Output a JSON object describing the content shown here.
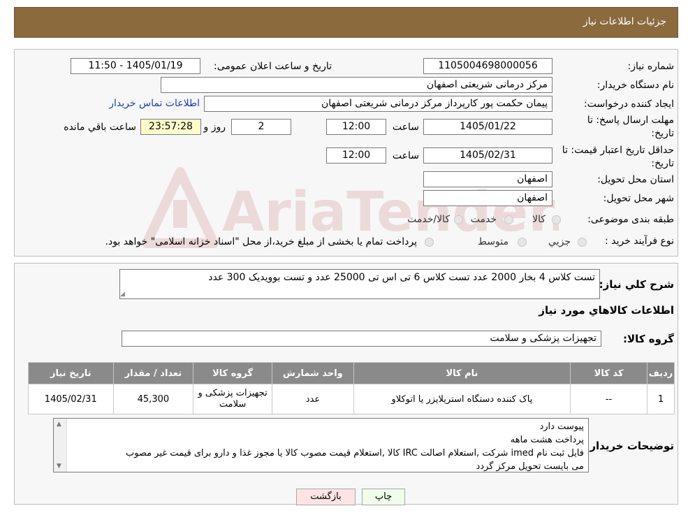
{
  "header": {
    "title": "جزئیات اطلاعات نیاز"
  },
  "fields": {
    "need_number_label": "شماره نیاز:",
    "need_number": "1105004698000056",
    "announce_label": "تاریخ و ساعت اعلان عمومی:",
    "announce_value": "1405/01/19 - 11:50",
    "buyer_org_label": "نام دستگاه خریدار:",
    "buyer_org": "مرکز درمانی شریعتی اصفهان",
    "requester_label": "ایجاد کننده درخواست:",
    "requester": "پیمان حکمت پور کارپرداز مرکز درمانی شریعتی اصفهان",
    "contact_link": "اطلاعات تماس خریدار",
    "deadline_label_1": "مهلت ارسال پاسخ: تا",
    "deadline_label_2": "تاریخ:",
    "deadline_date": "1405/01/22",
    "time_label": "ساعت",
    "deadline_time": "12:00",
    "days_value": "2",
    "days_label": "روز و",
    "remaining_time": "23:57:28",
    "remaining_label": "ساعت باقي مانده",
    "validity_label_1": "حداقل تاریخ اعتبار قیمت: تا",
    "validity_label_2": "تاریخ:",
    "validity_date": "1405/02/31",
    "validity_time": "12:00",
    "province_label": "استان محل تحویل:",
    "province": "اصفهان",
    "city_label": "شهر محل تحویل:",
    "city": "اصفهان",
    "category_label": "طبقه بندی موضوعی:",
    "category_options": [
      "کالا",
      "خدمت",
      "کالا/خدمت"
    ],
    "process_label": "نوع فرآیند خرید :",
    "process_options": [
      "جزیي",
      "متوسط"
    ],
    "process_note": "پرداخت تمام یا بخشی از مبلغ خرید،از محل \"اسناد خزانه اسلامی\" خواهد بود."
  },
  "summary": {
    "label": "شرح كلي نياز:",
    "text": "تست کلاس 4 بخار 2000 عدد تست کلاس 6 تی اس تی 25000 عدد و تست بوویدیک 300 عدد",
    "goods_info_title": "اطلاعات کالاهاي مورد نياز",
    "group_label": "گروه کالا:",
    "group_value": "تجهیزات پزشکی و سلامت"
  },
  "table": {
    "headers": [
      "رديف",
      "کد کالا",
      "نام کالا",
      "واحد شمارش",
      "گروه کالا",
      "تعداد / مقدار",
      "تاریخ نیاز"
    ],
    "rows": [
      {
        "row": "1",
        "code": "--",
        "name": "پاک کننده دستگاه استریلایزر یا اتوکلاو",
        "unit": "عدد",
        "group": "تجهیزات پزشکی و سلامت",
        "qty": "45,300",
        "date": "1405/02/31"
      }
    ]
  },
  "buyer_notes": {
    "label": "توضیحات خریدار:",
    "lines": [
      "پیوست دارد",
      "پرداخت هشت ماهه",
      "فایل ثبت نام imed شرکت ,استعلام اصالت IRC کالا ,استعلام قیمت مصوب کالا یا مجوز غذا و دارو برای قیمت غیر مصوب",
      "می بایست تحویل مرکز گردد"
    ]
  },
  "buttons": {
    "print": "چاپ",
    "back": "بازگشت"
  },
  "watermark": {
    "text": "AriaTender.neT"
  },
  "colors": {
    "header_bg": "#8b6a3e",
    "link": "#1a3fb0",
    "table_header": "#8a8a8a",
    "print_btn": "#f0fde8",
    "back_btn": "#fde4e4"
  }
}
